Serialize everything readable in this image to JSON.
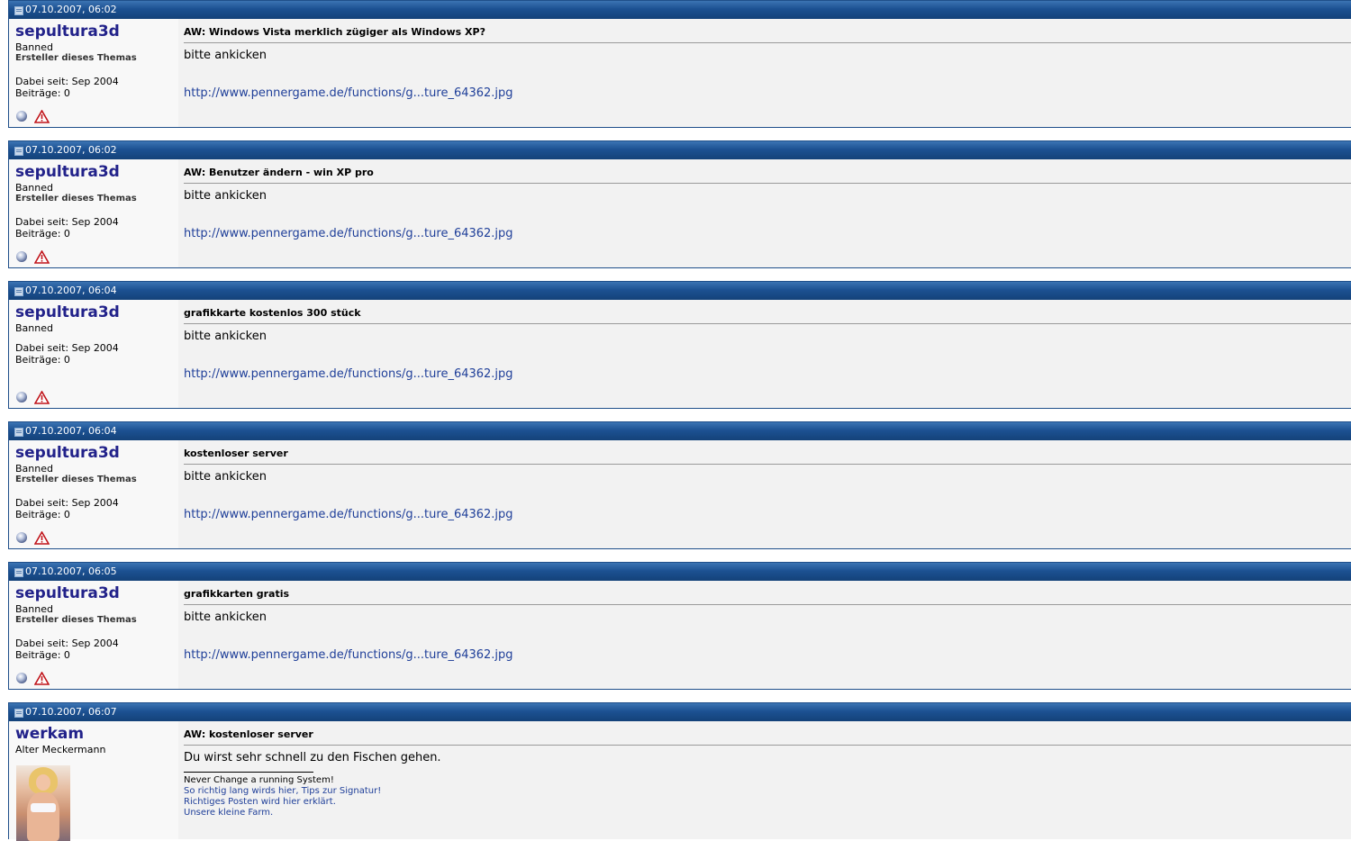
{
  "icons": {
    "post_icon": "post-document-icon",
    "status": "offline-status-icon",
    "report": "warning-triangle-icon"
  },
  "colors": {
    "header_blue": "#1c5192",
    "username": "#22228a",
    "link": "#1f3f99"
  },
  "posts": [
    {
      "date": "07.10.2007, 06:02",
      "username": "sepultura3d",
      "rank": "Banned",
      "starter": "Ersteller dieses Themas",
      "joined": "Dabei seit: Sep 2004",
      "post_count": "Beiträge: 0",
      "title": "AW: Windows Vista merklich zügiger als Windows XP?",
      "text": "bitte ankicken",
      "link": "http://www.pennergame.de/functions/g...ture_64362.jpg"
    },
    {
      "date": "07.10.2007, 06:02",
      "username": "sepultura3d",
      "rank": "Banned",
      "starter": "Ersteller dieses Themas",
      "joined": "Dabei seit: Sep 2004",
      "post_count": "Beiträge: 0",
      "title": "AW: Benutzer ändern - win XP pro",
      "text": "bitte ankicken",
      "link": "http://www.pennergame.de/functions/g...ture_64362.jpg"
    },
    {
      "date": "07.10.2007, 06:04",
      "username": "sepultura3d",
      "rank": "Banned",
      "joined": "Dabei seit: Sep 2004",
      "post_count": "Beiträge: 0",
      "title": "grafikkarte kostenlos 300 stück",
      "text": "bitte ankicken",
      "link": "http://www.pennergame.de/functions/g...ture_64362.jpg"
    },
    {
      "date": "07.10.2007, 06:04",
      "username": "sepultura3d",
      "rank": "Banned",
      "starter": "Ersteller dieses Themas",
      "joined": "Dabei seit: Sep 2004",
      "post_count": "Beiträge: 0",
      "title": "kostenloser server",
      "text": "bitte ankicken",
      "link": "http://www.pennergame.de/functions/g...ture_64362.jpg"
    },
    {
      "date": "07.10.2007, 06:05",
      "username": "sepultura3d",
      "rank": "Banned",
      "starter": "Ersteller dieses Themas",
      "joined": "Dabei seit: Sep 2004",
      "post_count": "Beiträge: 0",
      "title": "grafikkarten gratis",
      "text": "bitte ankicken",
      "link": "http://www.pennergame.de/functions/g...ture_64362.jpg"
    },
    {
      "date": "07.10.2007, 06:07",
      "username": "werkam",
      "rank": "Alter Meckermann",
      "title": "AW: kostenloser server",
      "text": "Du wirst sehr schnell zu den Fischen gehen.",
      "signature": {
        "line1": "Never Change a running System!",
        "links": [
          "So richtig lang wirds hier, Tips zur Signatur!",
          "Richtiges Posten wird hier erklärt.",
          "Unsere kleine Farm."
        ]
      }
    }
  ]
}
